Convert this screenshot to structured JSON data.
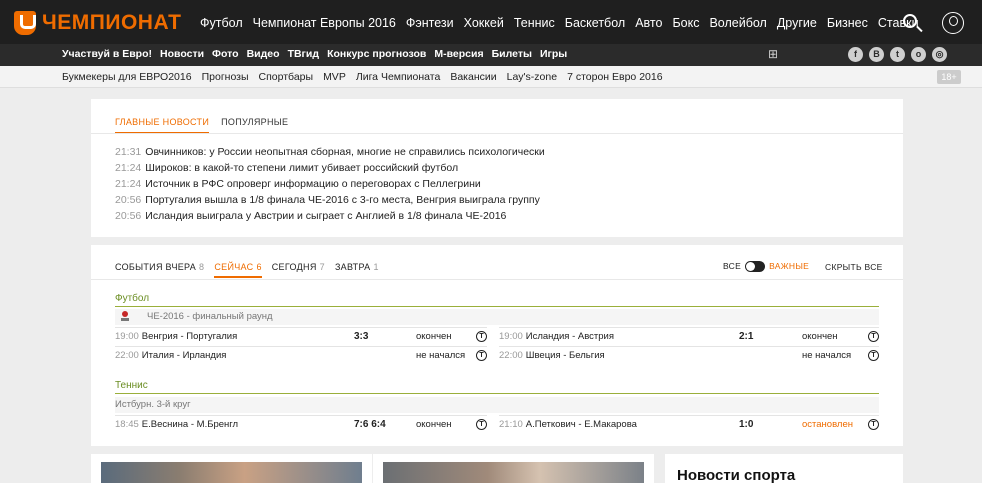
{
  "header": {
    "brand": "ЧЕМПИОНАТ",
    "nav": [
      "Футбол",
      "Чемпионат Европы 2016",
      "Фэнтези",
      "Хоккей",
      "Теннис",
      "Баскетбол",
      "Авто",
      "Бокс",
      "Волейбол",
      "Другие",
      "Бизнес",
      "Ставки"
    ],
    "icons": [
      "search-icon",
      "user-icon"
    ]
  },
  "subnav": {
    "items": [
      "Участвуй в Евро!",
      "Новости",
      "Фото",
      "Видео",
      "ТВгид",
      "Конкурс прогнозов",
      "М-версия",
      "Билеты",
      "Игры"
    ],
    "platforms": [
      "",
      "",
      "⊞"
    ],
    "platform_icons": [
      "apple-icon",
      "android-icon",
      "windows-icon"
    ],
    "socials": [
      "f",
      "В",
      "t",
      "o",
      "◎"
    ],
    "social_icons": [
      "facebook-icon",
      "vk-icon",
      "twitter-icon",
      "odnoklassniki-icon",
      "instagram-icon"
    ]
  },
  "thirdnav": {
    "items": [
      "Букмекеры для ЕВРО2016",
      "Прогнозы",
      "Спортбары",
      "MVP",
      "Лига Чемпионата",
      "Вакансии",
      "Lay's-zone",
      "7 сторон Евро 2016"
    ],
    "age_badge": "18+"
  },
  "news": {
    "tabs": [
      "ГЛАВНЫЕ НОВОСТИ",
      "ПОПУЛЯРНЫЕ"
    ],
    "items": [
      {
        "time": "21:31",
        "text": "Овчинников: у России неопытная сборная, многие не справились психологически"
      },
      {
        "time": "21:24",
        "text": "Широков: в какой-то степени лимит убивает российский футбол"
      },
      {
        "time": "21:24",
        "text": "Источник в РФС опроверг информацию о переговорах с Пеллегрини"
      },
      {
        "time": "20:56",
        "text": "Португалия вышла в 1/8 финала ЧЕ-2016 с 3-го места, Венгрия выиграла группу"
      },
      {
        "time": "20:56",
        "text": "Исландия выиграла у Австрии и сыграет с Англией в 1/8 финала ЧЕ-2016"
      }
    ]
  },
  "scores": {
    "tabs": [
      {
        "label": "СОБЫТИЯ ВЧЕРА",
        "count": "8"
      },
      {
        "label": "СЕЙЧАС",
        "count": "6"
      },
      {
        "label": "СЕГОДНЯ",
        "count": "7"
      },
      {
        "label": "ЗАВТРА",
        "count": "1"
      }
    ],
    "filter": {
      "all": "ВСЕ",
      "important": "ВАЖНЫЕ",
      "hide_all": "СКРЫТЬ ВСЕ"
    },
    "tv_glyph": "T",
    "football": {
      "title": "Футбол",
      "tournament": "ЧЕ-2016 - финальный раунд",
      "matches": [
        {
          "time": "19:00",
          "teams": "Венгрия - Португалия",
          "score": "3:3",
          "status": "окончен"
        },
        {
          "time": "19:00",
          "teams": "Исландия - Австрия",
          "score": "2:1",
          "status": "окончен"
        },
        {
          "time": "22:00",
          "teams": "Италия - Ирландия",
          "score": "",
          "status": "не начался"
        },
        {
          "time": "22:00",
          "teams": "Швеция - Бельгия",
          "score": "",
          "status": "не начался"
        }
      ]
    },
    "tennis": {
      "title": "Теннис",
      "tournament": "Истбурн. 3-й круг",
      "matches": [
        {
          "time": "18:45",
          "teams": "Е.Веснина - М.Бренгл",
          "score": "7:6 6:4",
          "status": "окончен"
        },
        {
          "time": "21:10",
          "teams": "А.Петкович - Е.Макарова",
          "score": "1:0",
          "status": "остановлен"
        }
      ]
    }
  },
  "sidebar": {
    "title": "Новости спорта"
  },
  "colors": {
    "accent": "#ef6c00",
    "topbar": "#1f1f1f",
    "sport_green": "#6b8e23"
  }
}
